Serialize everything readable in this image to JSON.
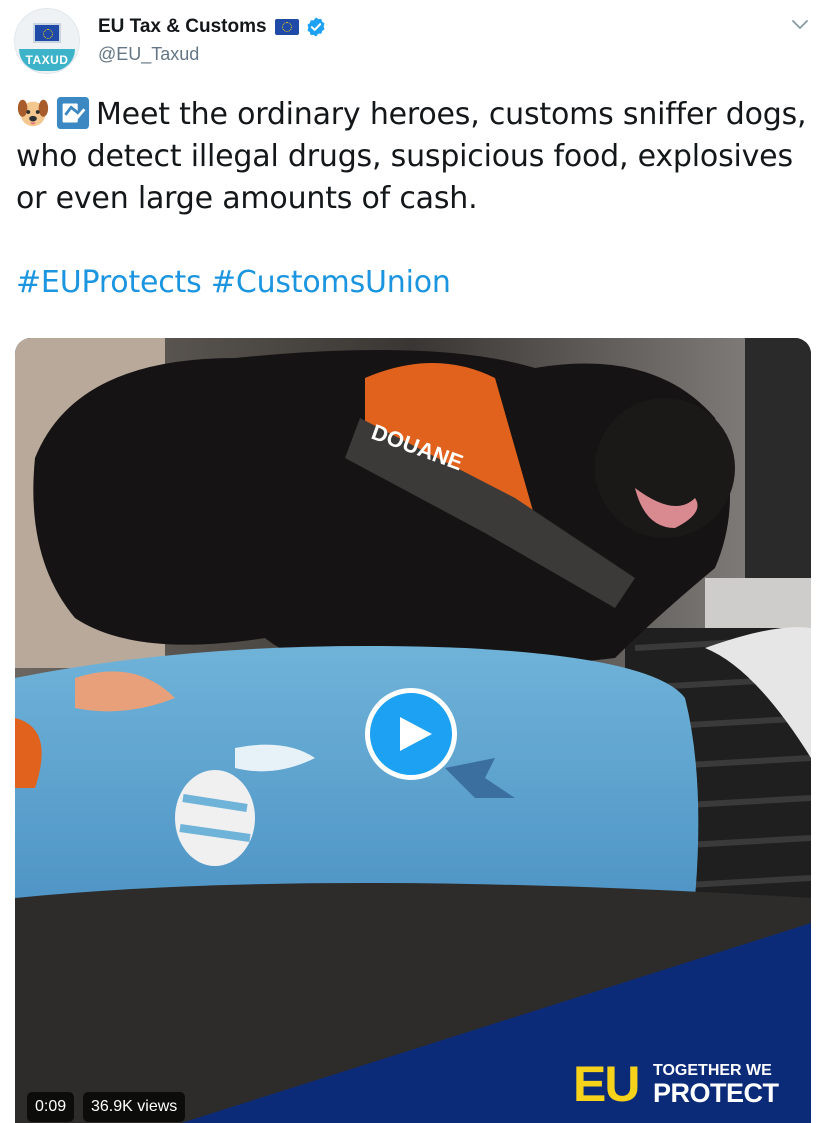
{
  "account": {
    "display_name": "EU Tax & Customs",
    "handle": "@EU_Taxud",
    "avatar_tag": "TAXUD",
    "verified": true
  },
  "tweet": {
    "text": "Meet the ordinary heroes, customs sniffer dogs, who detect illegal drugs, suspicious food, explosives or even large amounts of cash.",
    "leading_emojis": [
      "dog-face-icon",
      "customs-icon"
    ],
    "hashtags": [
      "#EUProtects",
      "#CustomsUnion"
    ]
  },
  "video": {
    "time": "0:09",
    "views": "36.9K views",
    "harness_label": "DOUANE",
    "brand_mark": "EU",
    "brand_line1": "TOGETHER WE",
    "brand_line2": "PROTECT"
  },
  "colors": {
    "link": "#1b95e0",
    "play_button": "#1da1f2",
    "brand_yellow": "#f6d21b",
    "brand_navy": "#0b2a78"
  }
}
